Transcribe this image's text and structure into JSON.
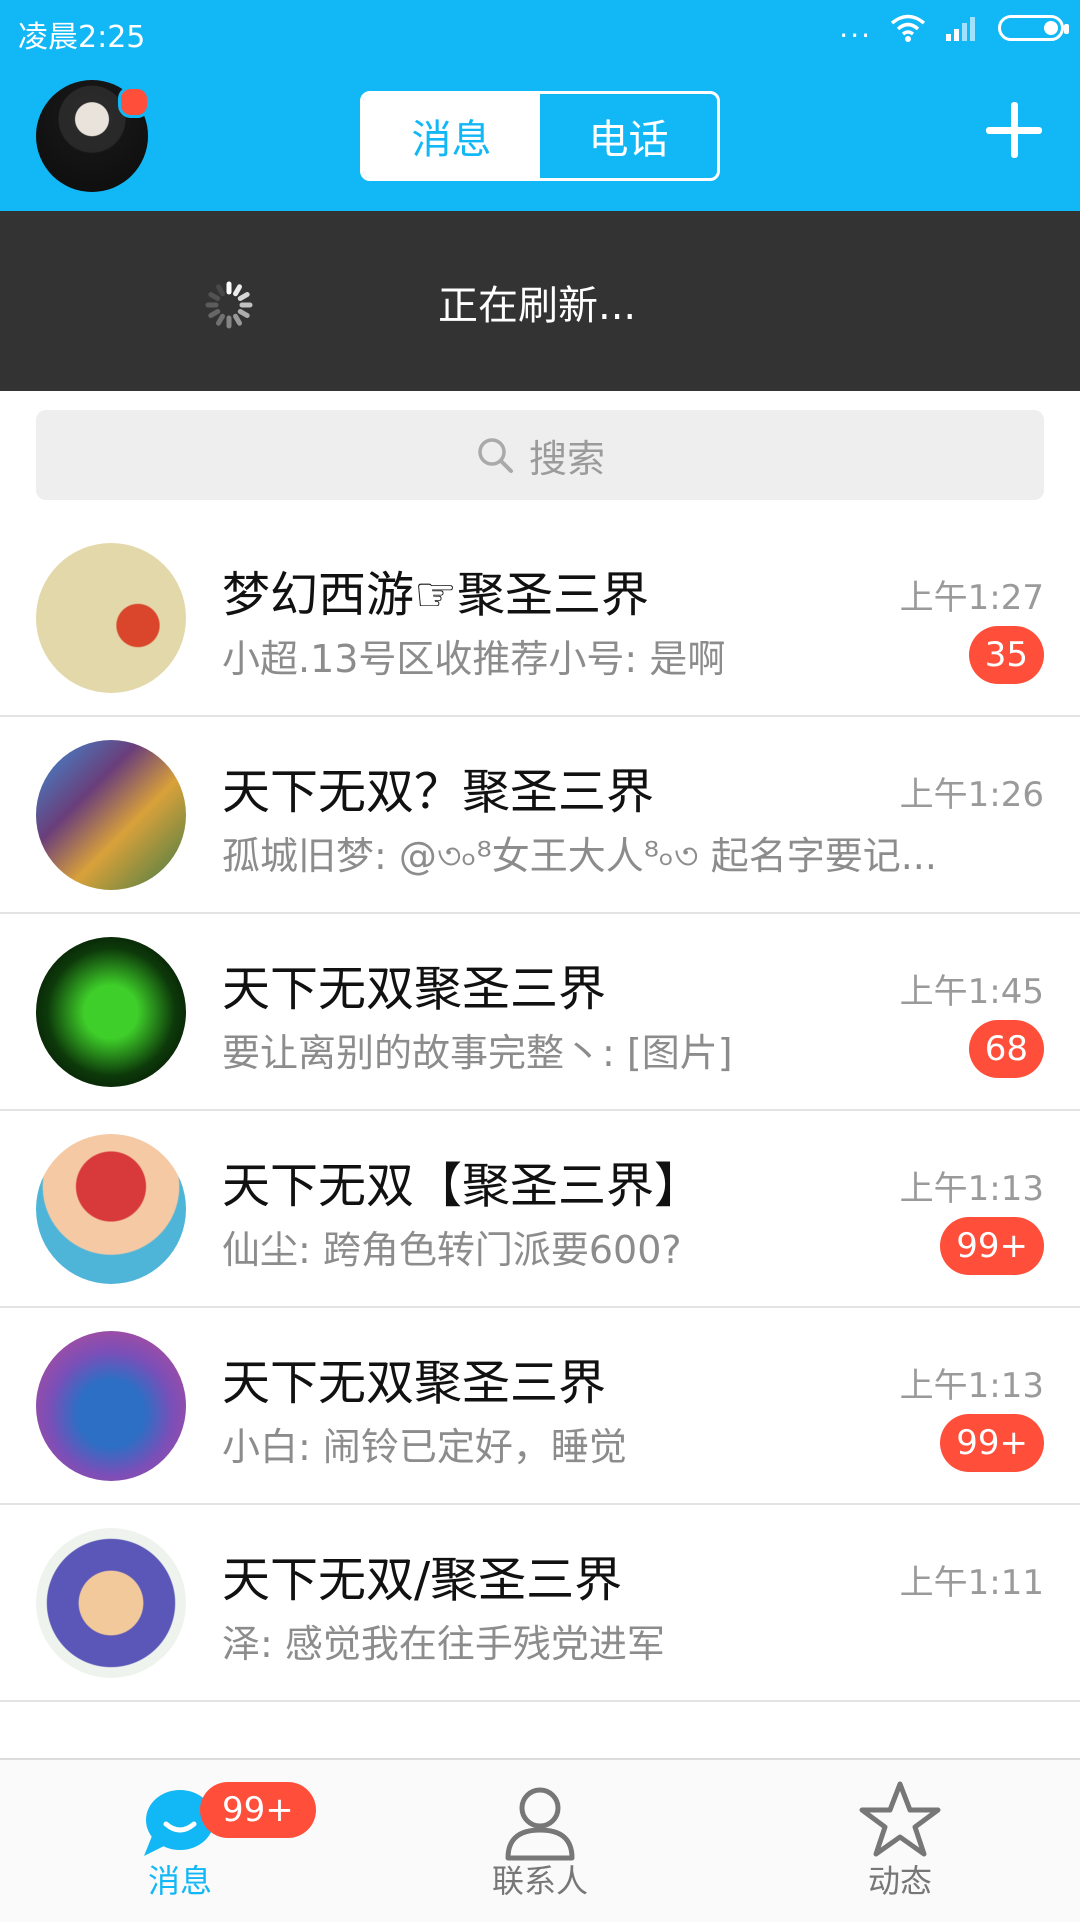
{
  "status_bar": {
    "time": "凌晨2:25",
    "dots": "..."
  },
  "header": {
    "tabs": [
      {
        "label": "消息"
      },
      {
        "label": "电话"
      }
    ]
  },
  "refresh": {
    "label": "正在刷新..."
  },
  "search": {
    "placeholder": "搜索"
  },
  "conversations": [
    {
      "title": "梦幻西游☞聚圣三界",
      "preview": "小超.13号区收推荐小号: 是啊",
      "time": "上午1:27",
      "badge": "35"
    },
    {
      "title": "天下无双？聚圣三界",
      "preview": "孤城旧梦: @৩৹⁸女王大人⁸৹৩ 起名字要记...",
      "time": "上午1:26",
      "badge": ""
    },
    {
      "title": "天下无双聚圣三界",
      "preview": "要让离别的故事完整丶: [图片]",
      "time": "上午1:45",
      "badge": "68"
    },
    {
      "title": "天下无双【聚圣三界】",
      "preview": "仙尘: 跨角色转门派要600?",
      "time": "上午1:13",
      "badge": "99+"
    },
    {
      "title": "天下无双聚圣三界",
      "preview": "小白: 闹铃已定好，睡觉",
      "time": "上午1:13",
      "badge": "99+"
    },
    {
      "title": "天下无双/聚圣三界",
      "preview": "泽: 感觉我在往手残党进军",
      "time": "上午1:11",
      "badge": ""
    }
  ],
  "bottom_nav": {
    "items": [
      {
        "label": "消息",
        "badge": "99+"
      },
      {
        "label": "联系人"
      },
      {
        "label": "动态"
      }
    ]
  },
  "colors": {
    "accent": "#12b7f5",
    "badge": "#ff4e3a",
    "refresh_bg": "#333333"
  },
  "icons": [
    "wifi-icon",
    "signal-icon",
    "battery-icon",
    "plus-icon",
    "spinner-icon",
    "search-icon",
    "chat-bubble-icon",
    "person-icon",
    "star-icon"
  ]
}
